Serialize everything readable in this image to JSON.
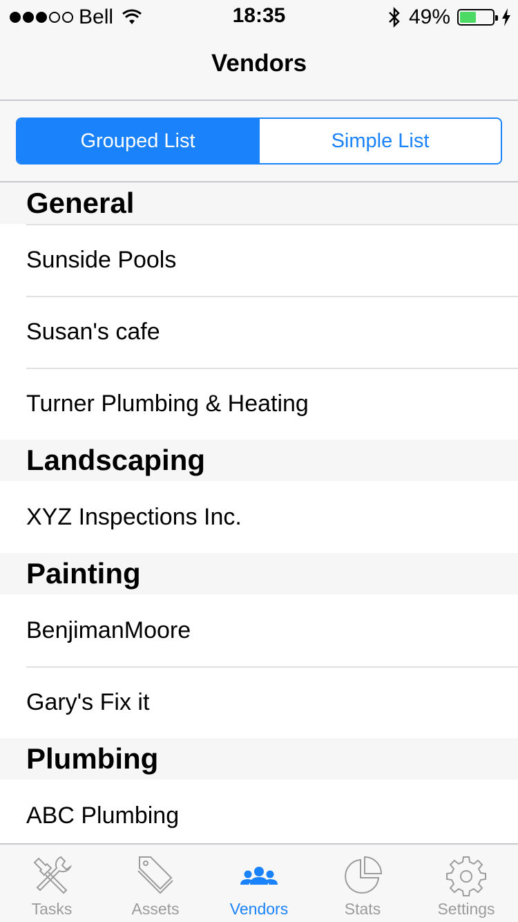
{
  "status_bar": {
    "carrier": "Bell",
    "time": "18:35",
    "battery_percent": "49%",
    "battery_level": 0.49,
    "signal_strength": 3
  },
  "nav": {
    "title": "Vendors"
  },
  "segments": {
    "grouped": "Grouped List",
    "simple": "Simple List",
    "selected": "grouped"
  },
  "sections": [
    {
      "title": "General",
      "items": [
        "Sunside Pools",
        "Susan's cafe",
        "Turner Plumbing & Heating"
      ]
    },
    {
      "title": "Landscaping",
      "items": [
        "XYZ Inspections Inc."
      ]
    },
    {
      "title": "Painting",
      "items": [
        "BenjimanMoore",
        "Gary's Fix it"
      ]
    },
    {
      "title": "Plumbing",
      "items": [
        "ABC Plumbing"
      ]
    }
  ],
  "tabs": [
    {
      "label": "Tasks",
      "icon": "tools-icon"
    },
    {
      "label": "Assets",
      "icon": "tag-icon"
    },
    {
      "label": "Vendors",
      "icon": "people-icon",
      "active": true
    },
    {
      "label": "Stats",
      "icon": "pie-chart-icon"
    },
    {
      "label": "Settings",
      "icon": "gear-icon"
    }
  ],
  "colors": {
    "accent": "#1a82fb",
    "inactive": "#9b9b9b",
    "battery": "#4cd964"
  }
}
